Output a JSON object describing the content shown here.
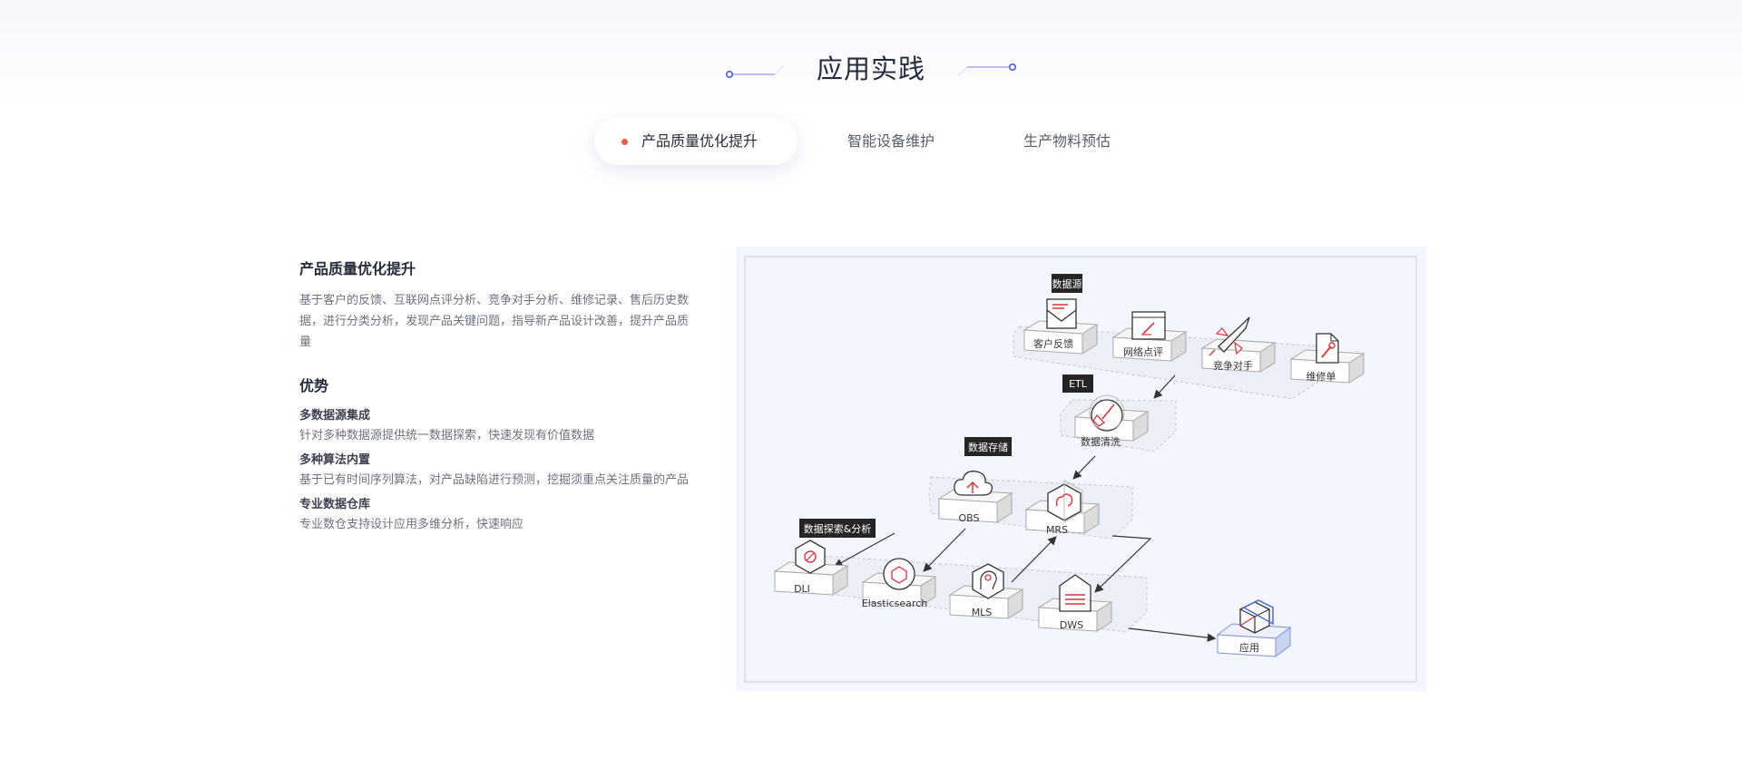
{
  "section_title": "应用实践",
  "tabs": [
    {
      "label": "产品质量优化提升",
      "active": true
    },
    {
      "label": "智能设备维护",
      "active": false
    },
    {
      "label": "生产物料预估",
      "active": false
    }
  ],
  "content": {
    "heading": "产品质量优化提升",
    "description": "基于客户的反馈、互联网点评分析、竞争对手分析、维修记录、售后历史数据，进行分类分析，发现产品关键问题，指导新产品设计改善，提升产品质量",
    "advantages_heading": "优势",
    "advantages": [
      {
        "title": "多数据源集成",
        "desc": "针对多种数据源提供统一数据探索，快速发现有价值数据"
      },
      {
        "title": "多种算法内置",
        "desc": "基于已有时间序列算法，对产品缺陷进行预测，挖掘须重点关注质量的产品"
      },
      {
        "title": "专业数据仓库",
        "desc": "专业数仓支持设计应用多维分析，快速响应"
      }
    ]
  },
  "diagram": {
    "groups": {
      "source": "数据源",
      "etl": "ETL",
      "storage": "数据存储",
      "analysis": "数据探索&分析"
    },
    "nodes": {
      "feedback": "客户反馈",
      "review": "网络点评",
      "competitor": "竞争对手",
      "repair": "维修单",
      "cleaning": "数据清洗",
      "obs": "OBS",
      "mrs": "MRS",
      "dli": "DLI",
      "es": "Elasticsearch",
      "mls": "MLS",
      "dws": "DWS",
      "app": "应用"
    },
    "icons": [
      "mail-icon",
      "browser-icon",
      "rocket-icon",
      "wrench-icon",
      "broom-icon",
      "cloud-icon",
      "hexagon-icon",
      "cube-icon"
    ],
    "colors": {
      "accent": "#e0303c",
      "background": "#f3f6fd",
      "label_bg": "#252525",
      "app_blue": "#4a6ad8"
    }
  },
  "colors": {
    "title_deco": "#5a6ae0",
    "active_dot": "#f2574a"
  }
}
